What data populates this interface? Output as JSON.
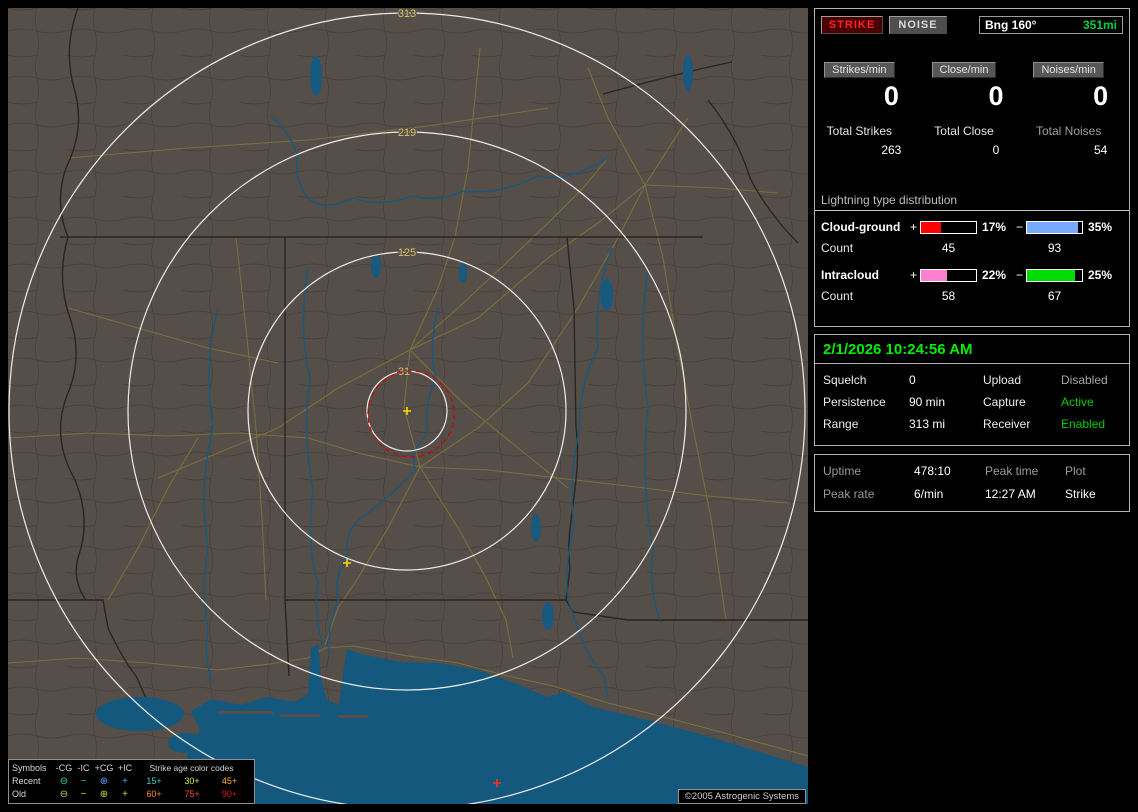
{
  "window": {
    "copyright": "©2005 Astrogenic Systems"
  },
  "map": {
    "rings": {
      "r313": "313",
      "r219": "219",
      "r125": "125",
      "r31": "31"
    },
    "legend": {
      "symbols_header": "Symbols",
      "col_neg_cg": "-CG",
      "col_neg_ic": "-IC",
      "col_pos_cg": "+CG",
      "col_pos_ic": "+IC",
      "age_header": "Strike age color codes",
      "recent_label": "Recent",
      "old_label": "Old",
      "glyph_circle_minus": "⊖",
      "glyph_minus": "−",
      "glyph_circle_plus": "⊕",
      "glyph_plus": "+",
      "recent_neg_style": "color:#2fd3c2",
      "recent_pos_style": "color:#5e9cff",
      "old_style": "color:#d3d23a",
      "a15": "15+",
      "a30": "30+",
      "a45": "45+",
      "a60": "60+",
      "a75": "75+",
      "a90": "90+",
      "a15_style": "color:#3fd0d0",
      "a30_style": "color:#e6e63a",
      "a45_style": "color:#ffb032",
      "a60_style": "color:#ff8c28",
      "a75_style": "color:#ff4a20",
      "a90_style": "color:#e01818"
    }
  },
  "sidebar": {
    "strike_button": "STRIKE",
    "noise_button": "NOISE",
    "bearing_label": "Bng 160°",
    "bearing_distance": "351mi",
    "rate_columns": [
      {
        "label": "Strikes/min",
        "rate": "0",
        "total_label": "Total Strikes",
        "total": "263",
        "total_label_style": "color:#e6e6e6"
      },
      {
        "label": "Close/min",
        "rate": "0",
        "total_label": "Total Close",
        "total": "0",
        "total_label_style": "color:#e6e6e6"
      },
      {
        "label": "Noises/min",
        "rate": "0",
        "total_label": "Total Noises",
        "total": "54",
        "total_label_style": "color:#9f9f9f"
      }
    ],
    "distribution": {
      "title": "Lightning type distribution",
      "cloud_ground": {
        "name": "Cloud-ground",
        "plus_sign": "+",
        "minus_sign": "−",
        "plus_pct": "17%",
        "minus_pct": "35%",
        "count_label": "Count",
        "plus_count": "45",
        "minus_count": "93",
        "plus_bar_style": "width:36%;background:#ff0000",
        "minus_bar_style": "width:92%;background:#76aaff"
      },
      "intracloud": {
        "name": "Intracloud",
        "plus_sign": "+",
        "minus_sign": "−",
        "plus_pct": "22%",
        "minus_pct": "25%",
        "count_label": "Count",
        "plus_count": "58",
        "minus_count": "67",
        "plus_bar_style": "width:47%;background:#ff7fd0",
        "minus_bar_style": "width:88%;background:#00dd00"
      }
    },
    "datetime": "2/1/2026 10:24:56 AM",
    "settings": [
      {
        "label": "Squelch",
        "value": "0",
        "label2": "Upload",
        "value2": "Disabled",
        "value2_style": "color:#a6a6a6"
      },
      {
        "label": "Persistence",
        "value": "90 min",
        "label2": "Capture",
        "value2": "Active",
        "value2_style": "color:#00cc00"
      },
      {
        "label": "Range",
        "value": "313 mi",
        "label2": "Receiver",
        "value2": "Enabled",
        "value2_style": "color:#00cc00"
      }
    ],
    "status": {
      "uptime_label": "Uptime",
      "uptime_value": "478:10",
      "peak_time_label": "Peak time",
      "peak_time_value": "12:27 AM",
      "plot_label": "Plot",
      "plot_value": "Strike",
      "peak_rate_label": "Peak rate",
      "peak_rate_value": "6/min"
    }
  }
}
